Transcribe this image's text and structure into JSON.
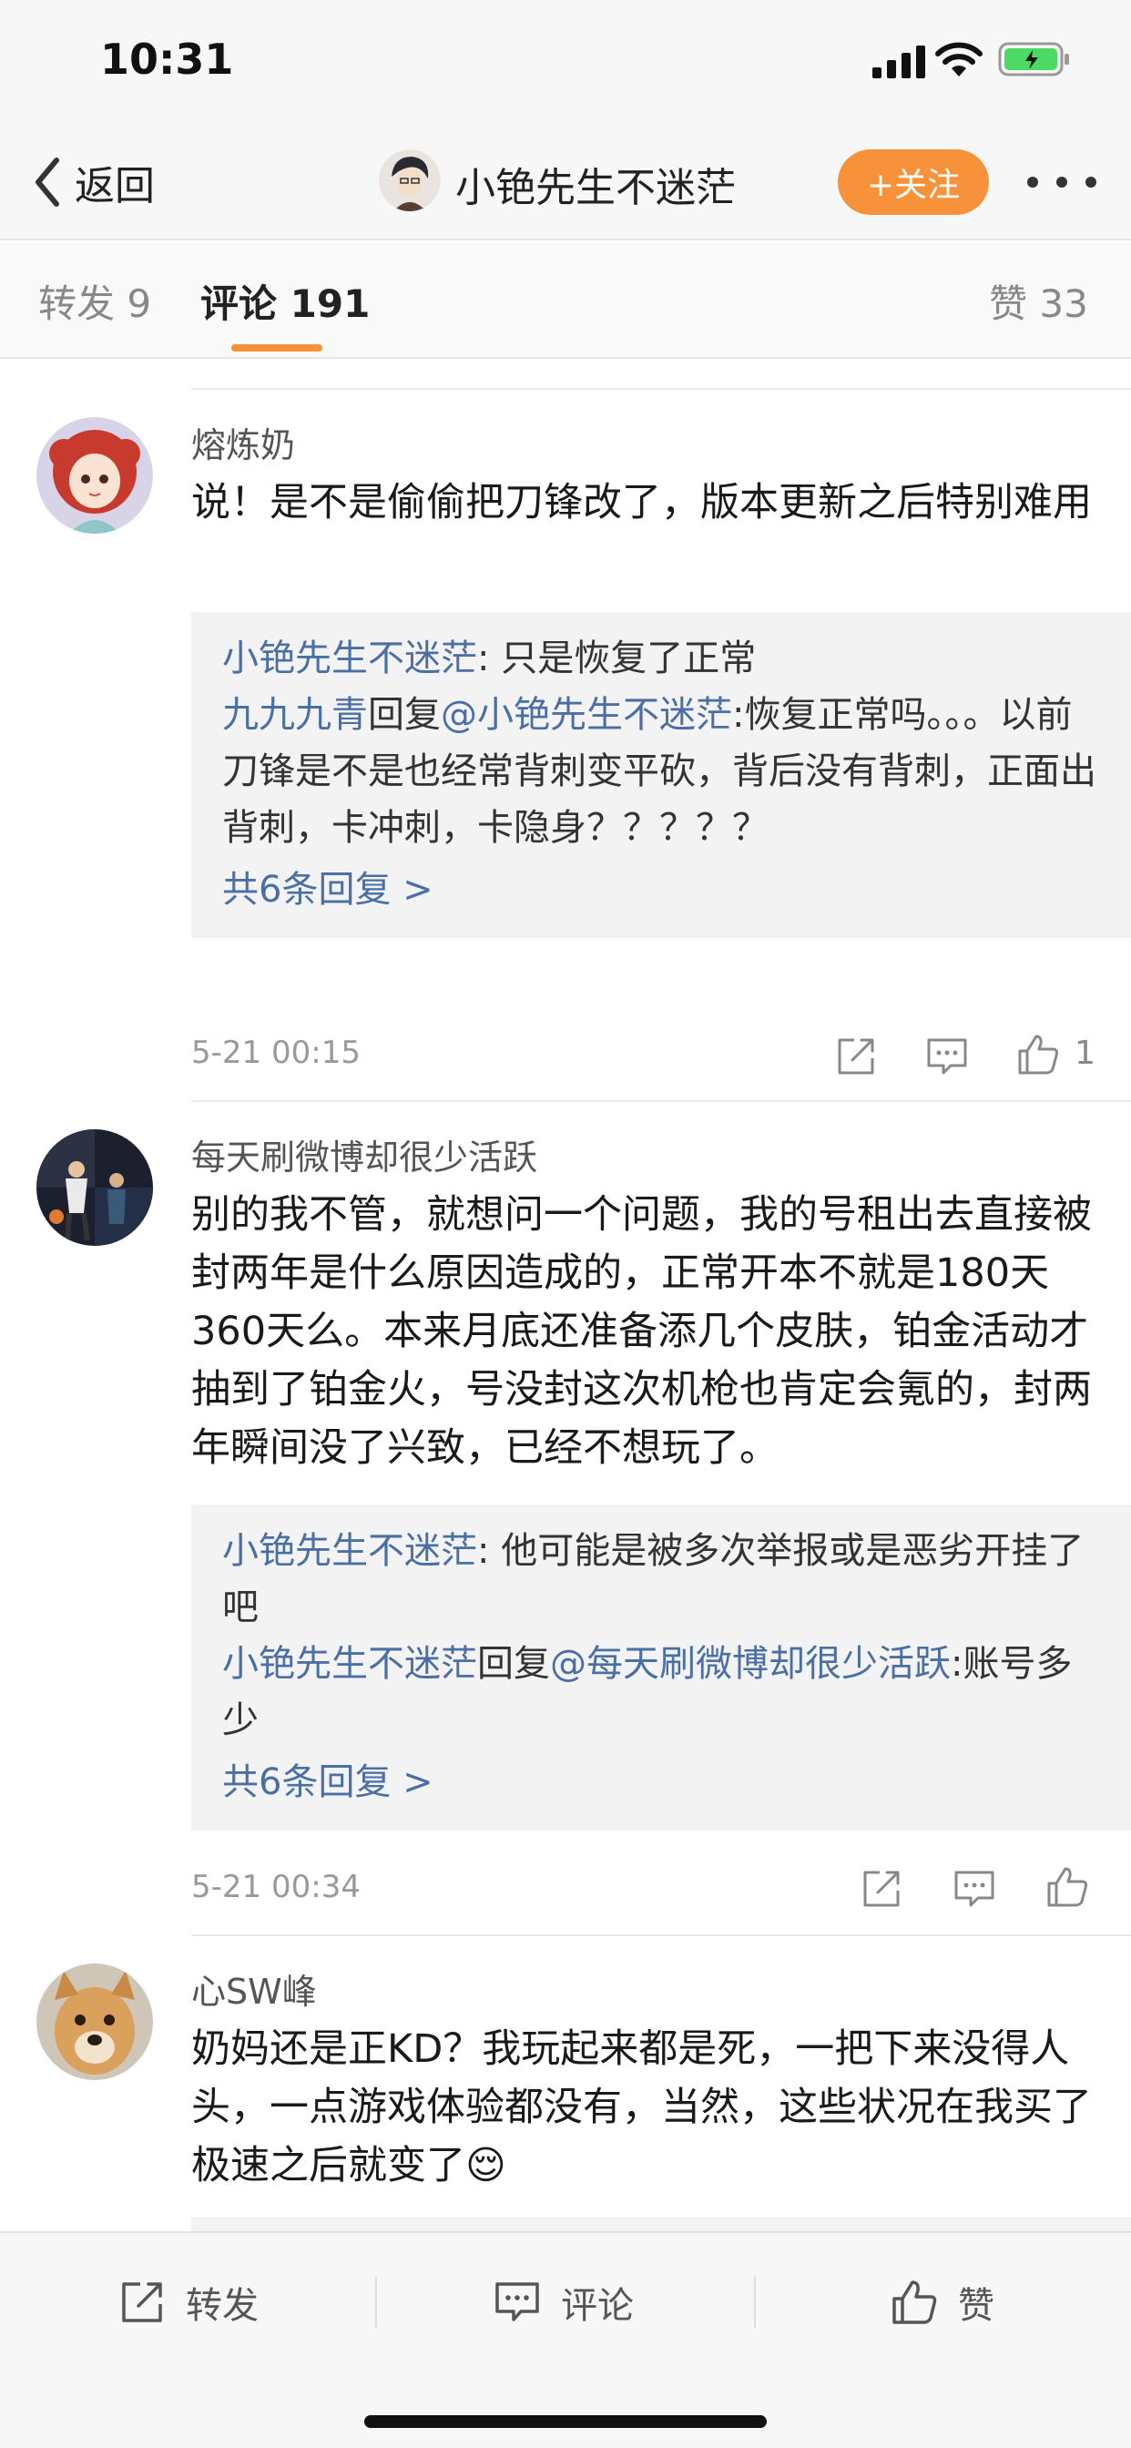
{
  "status": {
    "time": "10:31"
  },
  "nav": {
    "back_label": "返回",
    "title": "小铯先生不迷茫",
    "follow_label": "+关注"
  },
  "tabs": {
    "repost": "转发 9",
    "comments": "评论 191",
    "likes": "赞 33"
  },
  "comments": [
    {
      "name": "熔炼奶",
      "text": "说！是不是偷偷把刀锋改了，版本更新之后特别难用",
      "replies": [
        {
          "user": "小铯先生不迷茫",
          "text": ": 只是恢复了正常"
        },
        {
          "user": "九九九青",
          "mid": "回复",
          "target": "@小铯先生不迷茫",
          "text": ":恢复正常吗。。。以前刀锋是不是也经常背刺变平砍，背后没有背刺，正面出背刺，卡冲刺，卡隐身？？？？？"
        }
      ],
      "more": "共6条回复 >",
      "time": "5-21 00:15",
      "likes": "1"
    },
    {
      "name": "每天刷微博却很少活跃",
      "text": "别的我不管，就想问一个问题，我的号租出去直接被封两年是什么原因造成的，正常开本不就是180天360天么。本来月底还准备添几个皮肤，铂金活动才抽到了铂金火，号没封这次机枪也肯定会氪的，封两年瞬间没了兴致，已经不想玩了。",
      "replies": [
        {
          "user": "小铯先生不迷茫",
          "text": ": 他可能是被多次举报或是恶劣开挂了吧"
        },
        {
          "user": "小铯先生不迷茫",
          "mid": "回复",
          "target": "@每天刷微博却很少活跃",
          "text": ":账号多少"
        }
      ],
      "more": "共6条回复 >",
      "time": "5-21 00:34",
      "likes": ""
    },
    {
      "name": "心SW峰",
      "text": "奶妈还是正KD？我玩起来都是死，一把下来没得人头，一点游戏体验都没有，当然，这些状况在我买了极速之后就变了😌"
    }
  ],
  "toolbar": {
    "repost": "转发",
    "comment": "评论",
    "like": "赞"
  },
  "colors": {
    "accent": "#f7923a",
    "link": "#4a6fa5",
    "reply_bg": "#f3f3f3"
  },
  "icons": [
    "signal-icon",
    "wifi-icon",
    "battery-icon",
    "back-chevron-icon",
    "share-icon",
    "comment-icon",
    "like-icon"
  ]
}
